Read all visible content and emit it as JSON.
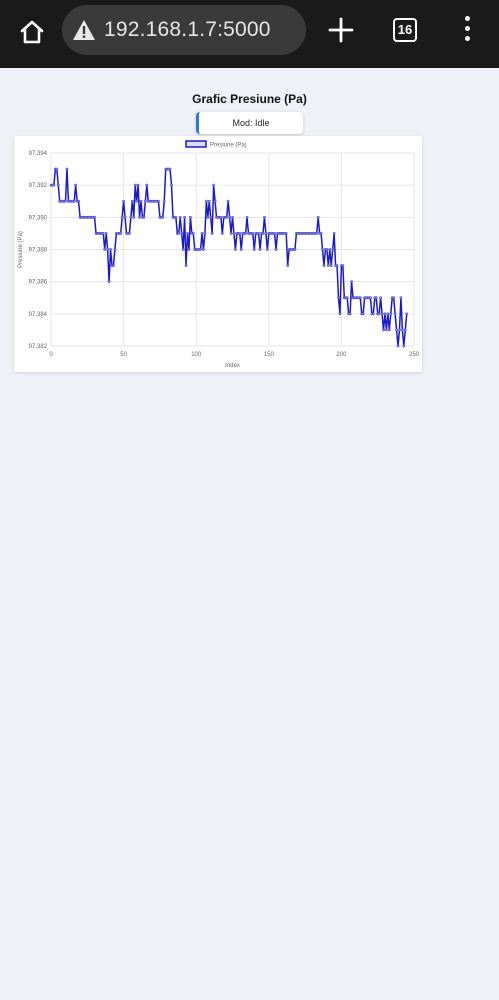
{
  "browser": {
    "url": "192.168.1.7:5000",
    "tab_count": "16"
  },
  "page": {
    "title": "Grafic Presiune (Pa)",
    "mode_label": "Mod: Idle"
  },
  "colors": {
    "series": "#1a1acc",
    "grid": "#e6e6e6"
  },
  "chart_data": {
    "type": "line",
    "title": "",
    "xlabel": "Index",
    "ylabel": "Presiune (Pa)",
    "xlim": [
      0,
      250
    ],
    "ylim": [
      97.382,
      97.394
    ],
    "x_ticks": [
      "0",
      "50",
      "100",
      "150",
      "200",
      "250"
    ],
    "y_ticks": [
      "97.382",
      "97.384",
      "97.386",
      "97.388",
      "97.390",
      "97.392",
      "97.394"
    ],
    "grid": true,
    "legend": "top-center",
    "series": [
      {
        "name": "Presiune (Pa)",
        "values": [
          97.392,
          97.392,
          97.392,
          97.393,
          97.393,
          97.392,
          97.391,
          97.391,
          97.391,
          97.391,
          97.391,
          97.393,
          97.391,
          97.391,
          97.391,
          97.391,
          97.391,
          97.392,
          97.391,
          97.391,
          97.39,
          97.39,
          97.39,
          97.39,
          97.39,
          97.39,
          97.39,
          97.39,
          97.39,
          97.39,
          97.39,
          97.389,
          97.389,
          97.389,
          97.389,
          97.389,
          97.389,
          97.388,
          97.389,
          97.388,
          97.386,
          97.388,
          97.387,
          97.387,
          97.388,
          97.389,
          97.389,
          97.389,
          97.389,
          97.39,
          97.391,
          97.39,
          97.389,
          97.389,
          97.389,
          97.39,
          97.391,
          97.39,
          97.392,
          97.391,
          97.392,
          97.39,
          97.391,
          97.39,
          97.39,
          97.391,
          97.392,
          97.391,
          97.391,
          97.391,
          97.391,
          97.391,
          97.391,
          97.391,
          97.391,
          97.39,
          97.39,
          97.39,
          97.391,
          97.393,
          97.393,
          97.393,
          97.393,
          97.392,
          97.39,
          97.39,
          97.39,
          97.389,
          97.389,
          97.39,
          97.389,
          97.388,
          97.39,
          97.387,
          97.389,
          97.388,
          97.39,
          97.389,
          97.389,
          97.388,
          97.388,
          97.388,
          97.388,
          97.388,
          97.389,
          97.388,
          97.389,
          97.391,
          97.39,
          97.391,
          97.39,
          97.389,
          97.392,
          97.391,
          97.39,
          97.39,
          97.39,
          97.39,
          97.389,
          97.39,
          97.39,
          97.39,
          97.391,
          97.39,
          97.389,
          97.39,
          97.389,
          97.388,
          97.389,
          97.389,
          97.389,
          97.388,
          97.389,
          97.389,
          97.389,
          97.39,
          97.389,
          97.389,
          97.389,
          97.389,
          97.388,
          97.389,
          97.389,
          97.389,
          97.388,
          97.389,
          97.389,
          97.39,
          97.389,
          97.388,
          97.389,
          97.389,
          97.389,
          97.389,
          97.389,
          97.388,
          97.389,
          97.389,
          97.389,
          97.389,
          97.389,
          97.389,
          97.389,
          97.387,
          97.388,
          97.388,
          97.388,
          97.388,
          97.388,
          97.389,
          97.389,
          97.389,
          97.389,
          97.389,
          97.389,
          97.389,
          97.389,
          97.389,
          97.389,
          97.389,
          97.389,
          97.389,
          97.389,
          97.389,
          97.39,
          97.389,
          97.389,
          97.388,
          97.387,
          97.388,
          97.388,
          97.387,
          97.388,
          97.387,
          97.388,
          97.389,
          97.387,
          97.387,
          97.385,
          97.384,
          97.387,
          97.387,
          97.385,
          97.385,
          97.385,
          97.384,
          97.384,
          97.386,
          97.385,
          97.385,
          97.385,
          97.385,
          97.385,
          97.385,
          97.384,
          97.384,
          97.385,
          97.385,
          97.385,
          97.385,
          97.385,
          97.384,
          97.384,
          97.385,
          97.385,
          97.384,
          97.384,
          97.385,
          97.384,
          97.383,
          97.384,
          97.383,
          97.384,
          97.383,
          97.384,
          97.385,
          97.385,
          97.384,
          97.383,
          97.382,
          97.383,
          97.385,
          97.383,
          97.382,
          97.383,
          97.384
        ]
      }
    ]
  }
}
